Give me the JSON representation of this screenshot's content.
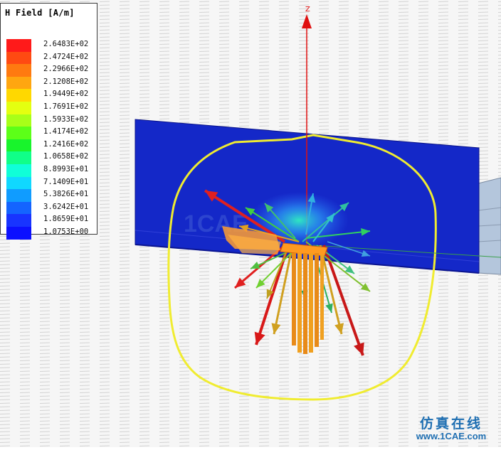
{
  "legend": {
    "title": "H Field [A/m]",
    "entries": [
      {
        "value": "2.6483E+02",
        "color": "#ff1a1a"
      },
      {
        "value": "2.4724E+02",
        "color": "#ff4a12"
      },
      {
        "value": "2.2966E+02",
        "color": "#ff7a10"
      },
      {
        "value": "2.1208E+02",
        "color": "#ffa610"
      },
      {
        "value": "1.9449E+02",
        "color": "#ffd800"
      },
      {
        "value": "1.7691E+02",
        "color": "#e4ff10"
      },
      {
        "value": "1.5933E+02",
        "color": "#a8ff18"
      },
      {
        "value": "1.4174E+02",
        "color": "#5cff18"
      },
      {
        "value": "1.2416E+02",
        "color": "#18f42c"
      },
      {
        "value": "1.0658E+02",
        "color": "#10ff88"
      },
      {
        "value": "8.8993E+01",
        "color": "#10ffd8"
      },
      {
        "value": "7.1409E+01",
        "color": "#10d8ff"
      },
      {
        "value": "5.3826E+01",
        "color": "#109cff"
      },
      {
        "value": "3.6242E+01",
        "color": "#1464ff"
      },
      {
        "value": "1.8659E+01",
        "color": "#1834ff"
      },
      {
        "value": "1.0753E+00",
        "color": "#0c10ff"
      }
    ]
  },
  "axis": {
    "z_label": "Z",
    "color": "#e01010"
  },
  "scene": {
    "plate_color": "#1428c8",
    "boundary_color": "#f0ec30",
    "background": "#f4f4f4"
  },
  "watermark": {
    "chinese": "仿真在线",
    "url": "www.1CAE.com",
    "faint": "1CAE"
  }
}
